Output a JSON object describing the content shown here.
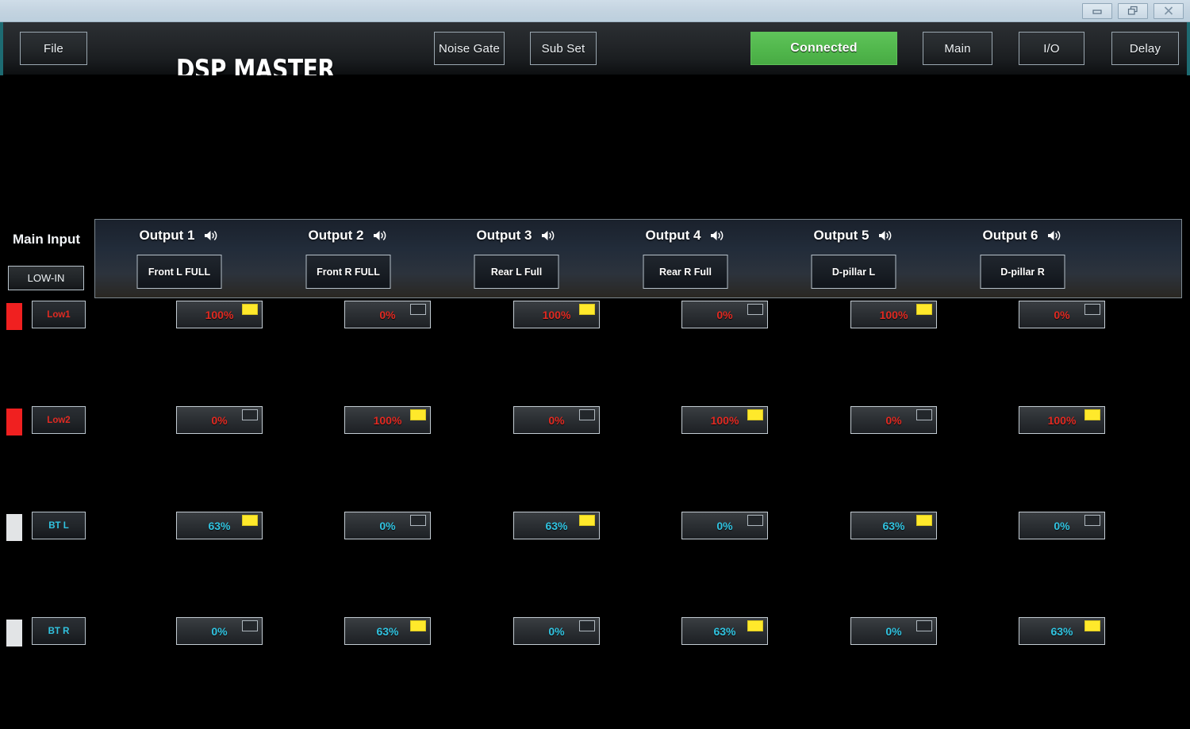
{
  "window": {
    "controls": [
      {
        "name": "minimize",
        "glyph": "minimize-icon"
      },
      {
        "name": "restore",
        "glyph": "restore-icon"
      },
      {
        "name": "close",
        "glyph": "close-icon"
      }
    ]
  },
  "header": {
    "logo": "DSP MASTER",
    "file_label": "File",
    "noise_gate_label": "Noise Gate",
    "sub_set_label": "Sub Set",
    "connection_status": "Connected",
    "connection_color": "#52b84d",
    "main_label": "Main",
    "io_label": "I/O",
    "delay_label": "Delay"
  },
  "main_input": {
    "title": "Main Input",
    "source_label": "LOW-IN"
  },
  "outputs": [
    {
      "title": "Output 1",
      "icon": "speaker-icon",
      "name": "Front L FULL"
    },
    {
      "title": "Output 2",
      "icon": "speaker-icon",
      "name": "Front R FULL"
    },
    {
      "title": "Output 3",
      "icon": "speaker-icon",
      "name": "Rear L Full"
    },
    {
      "title": "Output 4",
      "icon": "speaker-icon",
      "name": "Rear R Full"
    },
    {
      "title": "Output 5",
      "icon": "speaker-icon",
      "name": "D-pillar L"
    },
    {
      "title": "Output 6",
      "icon": "speaker-icon",
      "name": "D-pillar R"
    }
  ],
  "matrix": {
    "rows": [
      {
        "label": "Low1",
        "swatch_color": "#f02020",
        "text_color": "#e02a22",
        "cells": [
          {
            "value": "100%",
            "active": true
          },
          {
            "value": "0%",
            "active": false
          },
          {
            "value": "100%",
            "active": true
          },
          {
            "value": "0%",
            "active": false
          },
          {
            "value": "100%",
            "active": true
          },
          {
            "value": "0%",
            "active": false
          }
        ]
      },
      {
        "label": "Low2",
        "swatch_color": "#f02020",
        "text_color": "#e02a22",
        "cells": [
          {
            "value": "0%",
            "active": false
          },
          {
            "value": "100%",
            "active": true
          },
          {
            "value": "0%",
            "active": false
          },
          {
            "value": "100%",
            "active": true
          },
          {
            "value": "0%",
            "active": false
          },
          {
            "value": "100%",
            "active": true
          }
        ]
      },
      {
        "label": "BT L",
        "swatch_color": "#e2e4e6",
        "text_color": "#31c3e0",
        "cells": [
          {
            "value": "63%",
            "active": true
          },
          {
            "value": "0%",
            "active": false
          },
          {
            "value": "63%",
            "active": true
          },
          {
            "value": "0%",
            "active": false
          },
          {
            "value": "63%",
            "active": true
          },
          {
            "value": "0%",
            "active": false
          }
        ]
      },
      {
        "label": "BT R",
        "swatch_color": "#e2e4e6",
        "text_color": "#31c3e0",
        "cells": [
          {
            "value": "0%",
            "active": false
          },
          {
            "value": "63%",
            "active": true
          },
          {
            "value": "0%",
            "active": false
          },
          {
            "value": "63%",
            "active": true
          },
          {
            "value": "0%",
            "active": false
          },
          {
            "value": "63%",
            "active": true
          }
        ]
      }
    ]
  }
}
